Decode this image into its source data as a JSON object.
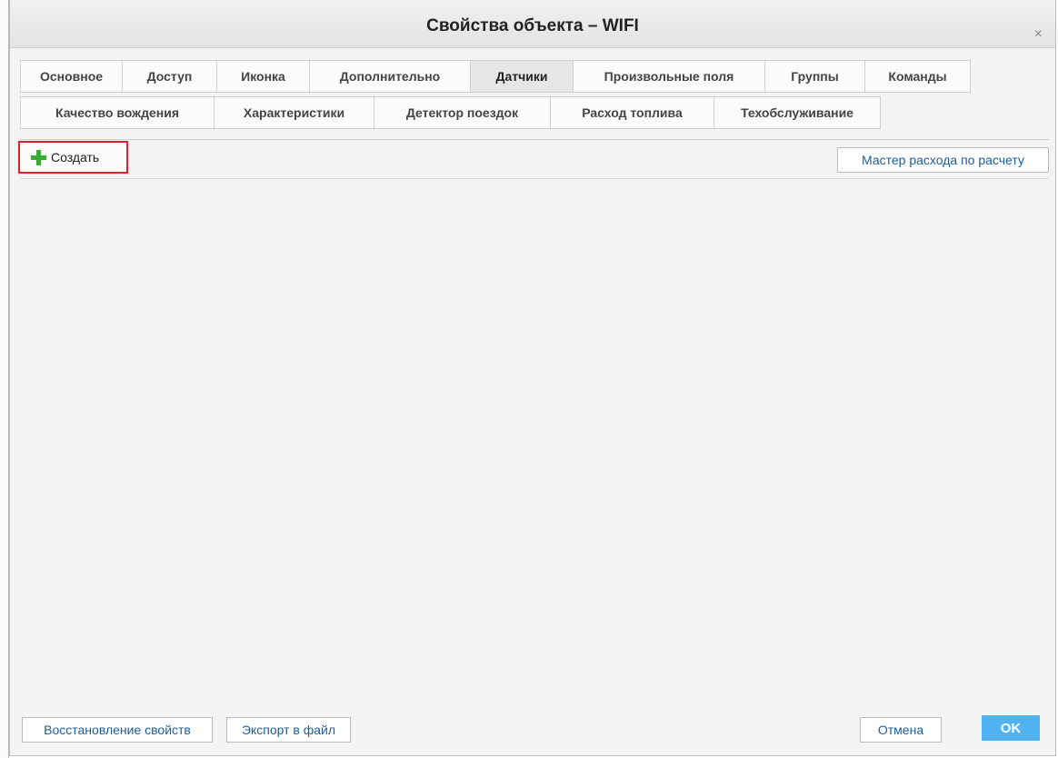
{
  "dialog": {
    "title": "Свойства объекта – WIFI",
    "close_symbol": "×"
  },
  "tabs": {
    "row1": [
      "Основное",
      "Доступ",
      "Иконка",
      "Дополнительно",
      "Датчики",
      "Произвольные поля",
      "Группы",
      "Команды"
    ],
    "row2": [
      "Качество вождения",
      "Характеристики",
      "Детектор поездок",
      "Расход топлива",
      "Техобслуживание"
    ],
    "active": "Датчики"
  },
  "toolbar": {
    "create_label": "Создать",
    "create_icon": "plus-icon",
    "wizard_label": "Мастер расхода по расчету"
  },
  "footer": {
    "restore_label": "Восстановление свойств",
    "export_label": "Экспорт в файл",
    "cancel_label": "Отмена",
    "ok_label": "OK"
  },
  "colors": {
    "accent_ok": "#4fb3f2",
    "highlight_border": "#e0202a",
    "plus_green": "#3aa935",
    "link_blue": "#1a5e9a"
  }
}
